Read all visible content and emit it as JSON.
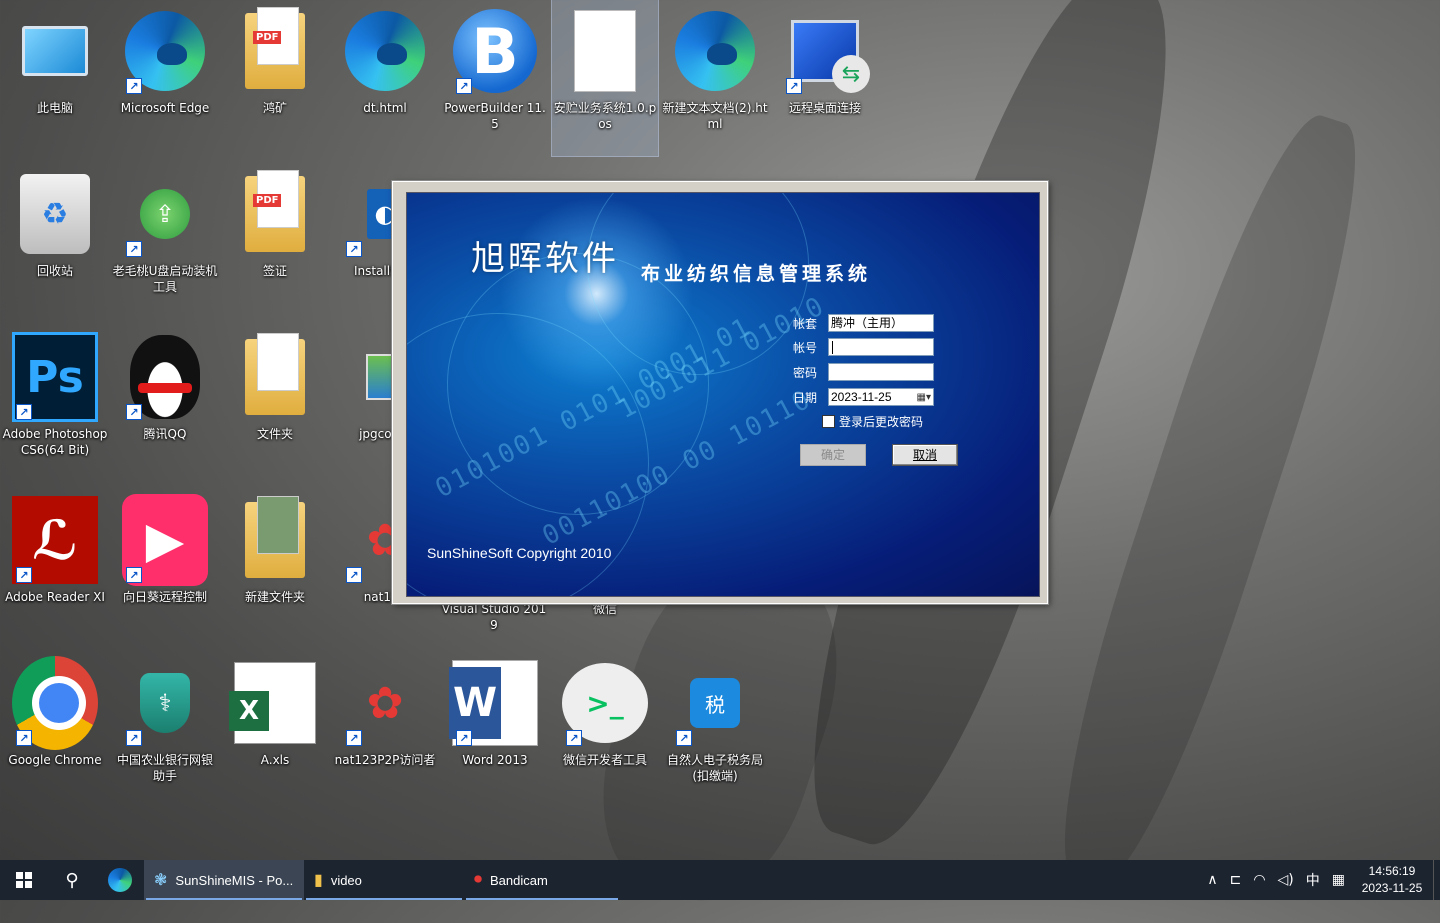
{
  "desktop": {
    "icons": [
      {
        "label": "此电脑"
      },
      {
        "label": "Microsoft Edge"
      },
      {
        "label": "鸿矿"
      },
      {
        "label": "dt.html"
      },
      {
        "label": "PowerBuilder 11.5"
      },
      {
        "label": "安贮业务系统1.0.pos"
      },
      {
        "label": "新建文本文档(2).html"
      },
      {
        "label": "远程桌面连接"
      },
      {
        "label": "回收站"
      },
      {
        "label": "老毛桃U盘启动装机工具"
      },
      {
        "label": "签证"
      },
      {
        "label": "InstallShie"
      },
      {
        "label": "Adobe Photoshop CS6(64 Bit)"
      },
      {
        "label": "腾讯QQ"
      },
      {
        "label": "文件夹"
      },
      {
        "label": "jpgcomp"
      },
      {
        "label": "Adobe Reader XI"
      },
      {
        "label": "向日葵远程控制"
      },
      {
        "label": "新建文件夹"
      },
      {
        "label": "nat123"
      },
      {
        "label": "Visual Studio 2019"
      },
      {
        "label": "微信"
      },
      {
        "label": "Google Chrome"
      },
      {
        "label": "中国农业银行网银助手"
      },
      {
        "label": "A.xls"
      },
      {
        "label": "nat123P2P访问者"
      },
      {
        "label": "Word 2013"
      },
      {
        "label": "微信开发者工具"
      },
      {
        "label": "自然人电子税务局(扣缴端)"
      }
    ]
  },
  "login": {
    "brand": "旭晖软件",
    "subtitle": "布业纺织信息管理系统",
    "account_set_label": "帐套",
    "account_set_value": "腾冲（主用）",
    "account_label": "帐号",
    "account_value": "",
    "password_label": "密码",
    "password_value": "",
    "date_label": "日期",
    "date_value": "2023-11-25",
    "change_pwd_label": "登录后更改密码",
    "ok_label": "确定",
    "cancel_label": "取消",
    "copyright": "SunShineSoft Copyright 2010"
  },
  "taskbar": {
    "apps": [
      {
        "label": "SunShineMIS - Po..."
      },
      {
        "label": "video"
      },
      {
        "label": "Bandicam"
      }
    ],
    "tray": {
      "ime": "中",
      "time": "14:56:19",
      "date": "2023-11-25"
    }
  }
}
